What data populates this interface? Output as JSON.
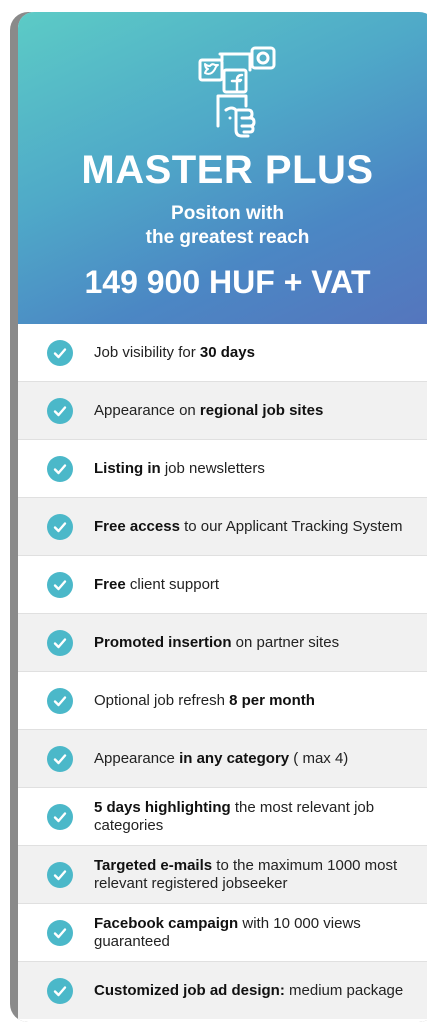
{
  "plan": {
    "title": "MASTER PLUS",
    "subtitle_line1": "Positon with",
    "subtitle_line2": "the greatest reach",
    "price": "149 900 HUF + VAT",
    "logo_icon": "social-media-phone-icon",
    "colors": {
      "header_gradient_start": "#5ccbc6",
      "header_gradient_end": "#5575bd",
      "check": "#4bb8c9",
      "frame": "#8a8a8a"
    }
  },
  "features": [
    {
      "pre": "Job visibility for ",
      "bold": "30 days",
      "post": ""
    },
    {
      "pre": "Appearance on ",
      "bold": "regional job sites",
      "post": ""
    },
    {
      "pre": "",
      "bold": "Listing in",
      "post": " job newsletters"
    },
    {
      "pre": "",
      "bold": "Free access",
      "post": " to our Applicant Tracking System"
    },
    {
      "pre": "",
      "bold": "Free",
      "post": " client support"
    },
    {
      "pre": "",
      "bold": "Promoted insertion",
      "post": " on partner sites"
    },
    {
      "pre": "Optional job refresh ",
      "bold": "8 per month",
      "post": ""
    },
    {
      "pre": "Appearance ",
      "bold": "in any category",
      "post": " ( max 4)"
    },
    {
      "pre": "",
      "bold": "5 days highlighting",
      "post": " the most relevant job categories"
    },
    {
      "pre": "",
      "bold": "Targeted e-mails",
      "post": " to the maximum 1000 most relevant registered jobseeker"
    },
    {
      "pre": "",
      "bold": "Facebook campaign",
      "post": " with 10 000 views guaranteed"
    },
    {
      "pre": "",
      "bold": "Customized job ad design:",
      "post": " medium package"
    }
  ]
}
